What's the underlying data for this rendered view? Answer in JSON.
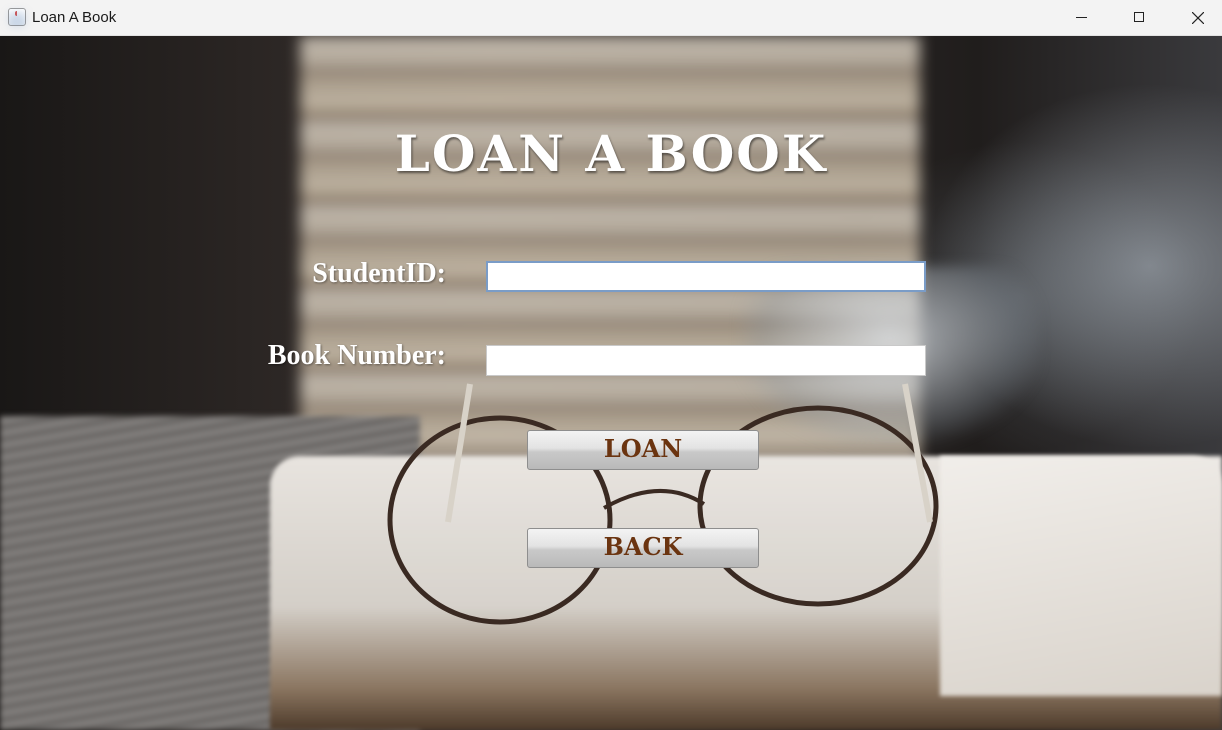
{
  "window": {
    "title": "Loan A Book",
    "icon": "java-cup-icon",
    "controls": [
      "minimize-icon",
      "maximize-icon",
      "close-icon"
    ]
  },
  "form": {
    "heading": "LOAN A BOOK",
    "student_id_label": "StudentID:",
    "student_id_value": "",
    "book_number_label": "Book Number:",
    "book_number_value": "",
    "loan_button": "LOAN",
    "back_button": "BACK"
  },
  "colors": {
    "button_text": "#6b3410",
    "label_text": "#ffffff",
    "focus_border": "#7a9cc7"
  }
}
